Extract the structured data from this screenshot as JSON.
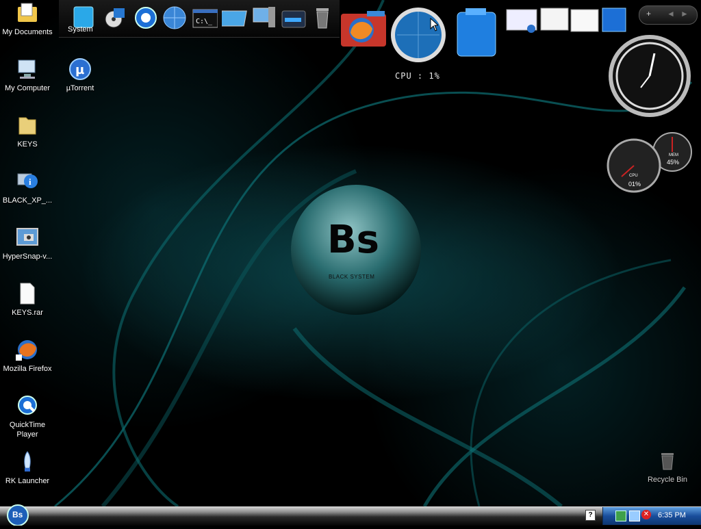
{
  "desktop_icons": [
    {
      "label": "My Documents",
      "icon": "my-documents-icon"
    },
    {
      "label": "My Computer",
      "icon": "my-computer-icon"
    },
    {
      "label": "KEYS",
      "icon": "folder-icon"
    },
    {
      "label": "BLACK_XP_...",
      "icon": "info-icon"
    },
    {
      "label": "HyperSnap-v...",
      "icon": "hypersnap-icon"
    },
    {
      "label": "KEYS.rar",
      "icon": "file-icon"
    },
    {
      "label": "Mozilla Firefox",
      "icon": "firefox-icon"
    },
    {
      "label": "QuickTime Player",
      "icon": "quicktime-icon"
    },
    {
      "label": "RK Launcher",
      "icon": "rocket-icon"
    },
    {
      "label": "µTorrent",
      "icon": "utorrent-icon"
    }
  ],
  "recycle_bin": {
    "label": "Recycle Bin"
  },
  "dock": {
    "system_label": "System",
    "cpu_text": "CPU : 1%"
  },
  "gauges": {
    "gauge_left_label": "CPU",
    "gauge_left_value": "01%",
    "gauge_right_label": "MEM",
    "gauge_right_value": "45%"
  },
  "taskbar": {
    "clock": "6:35 PM",
    "start_label": "Bs"
  },
  "wallpaper": {
    "logo_text": "Bs",
    "logo_subtitle": "BLACK SYSTEM"
  },
  "colors": {
    "accent": "#0e8a8c",
    "taskbar_tray": "#1a4e9c"
  }
}
